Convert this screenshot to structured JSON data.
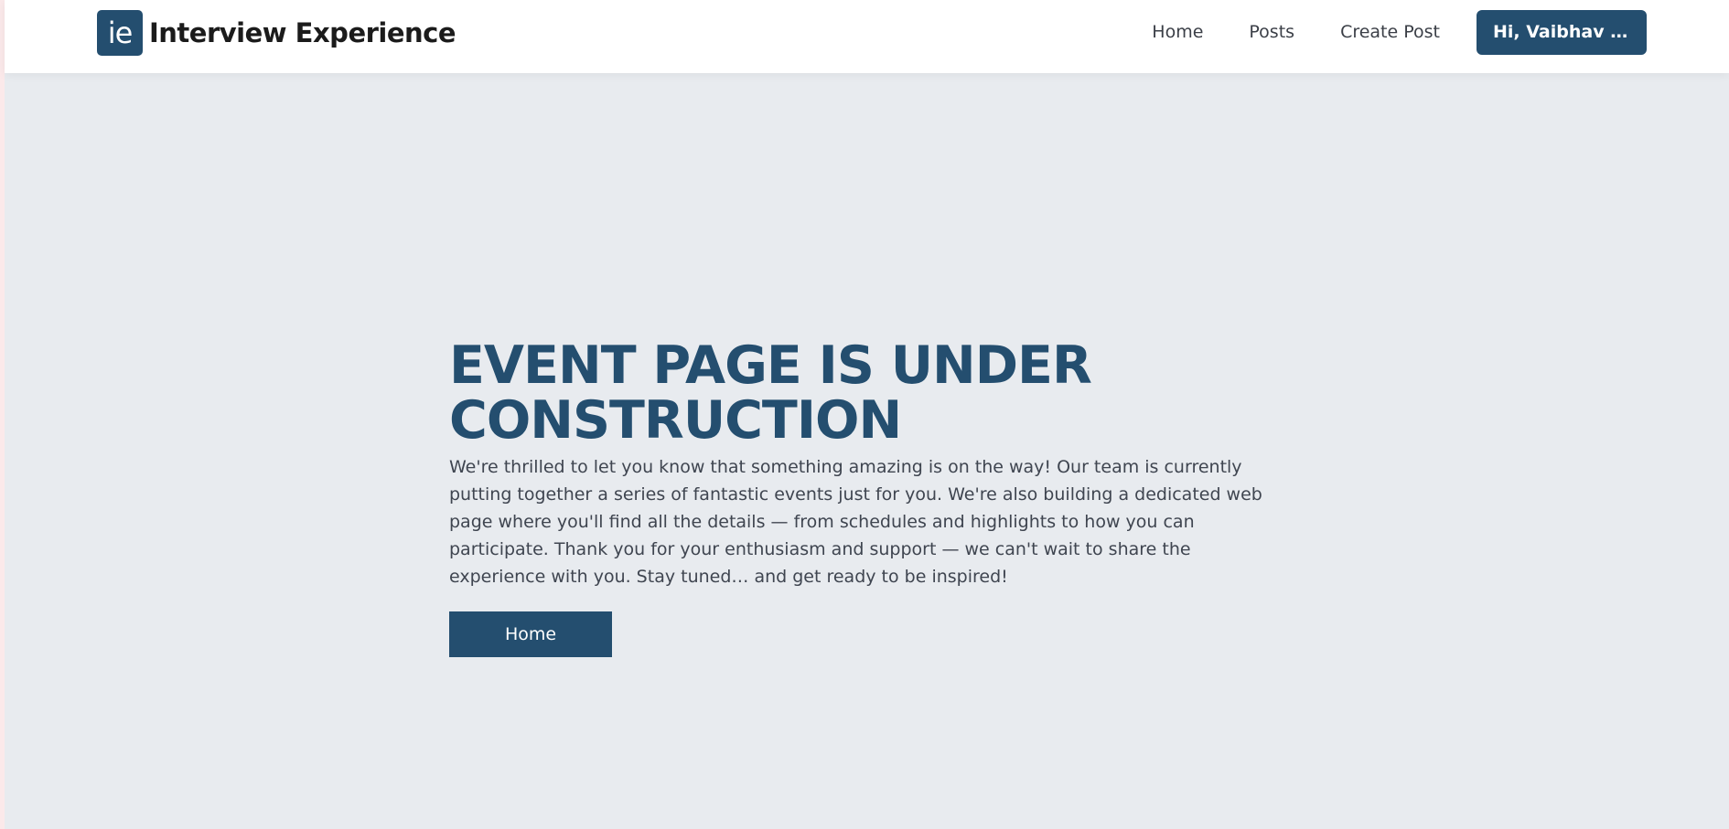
{
  "navbar": {
    "logo_text": "ie",
    "brand_name": "Interview Experience",
    "links": [
      {
        "label": "Home"
      },
      {
        "label": "Posts"
      },
      {
        "label": "Create Post"
      }
    ],
    "user_button_label": "Hi, Vaibhav P..."
  },
  "main": {
    "headline": "EVENT PAGE IS UNDER CONSTRUCTION",
    "description": "We're thrilled to let you know that something amazing is on the way! Our team is currently putting together a series of fantastic events just for you. We're also building a dedicated web page where you'll find all the details — from schedules and highlights to how you can participate. Thank you for your enthusiasm and support — we can't wait to share the experience with you. Stay tuned… and get ready to be inspired!",
    "home_button_label": "Home"
  },
  "colors": {
    "accent": "#244e6f",
    "page_background": "#e8ebef",
    "navbar_background": "#ffffff"
  }
}
